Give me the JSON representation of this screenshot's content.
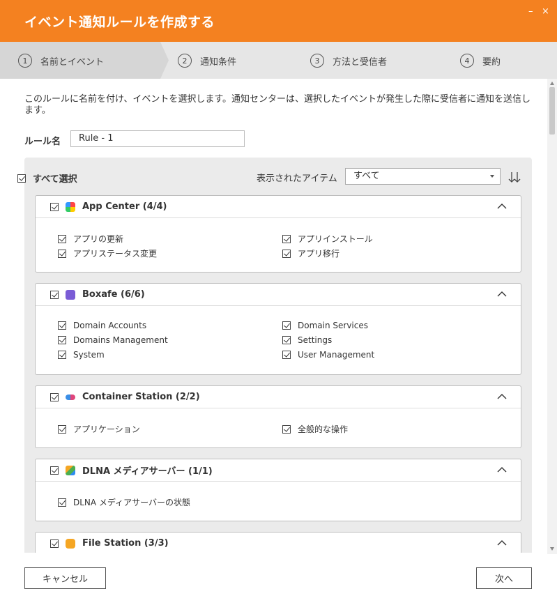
{
  "dialog": {
    "title": "イベント通知ルールを作成する",
    "minimize": "–",
    "close": "×"
  },
  "steps": [
    {
      "num": "1",
      "label": "名前とイベント"
    },
    {
      "num": "2",
      "label": "通知条件"
    },
    {
      "num": "3",
      "label": "方法と受信者"
    },
    {
      "num": "4",
      "label": "要約"
    }
  ],
  "description": "このルールに名前を付け、イベントを選択します。通知センターは、選択したイベントが発生した際に受信者に通知を送信します。",
  "rule": {
    "label": "ルール名",
    "value": "Rule - 1"
  },
  "filter": {
    "select_all": "すべて選択",
    "shown_label": "表示されたアイテム",
    "shown_value": "すべて"
  },
  "groups": [
    {
      "name": "App Center (4/4)",
      "icon": "app-center-icon",
      "items": [
        "アプリの更新",
        "アプリインストール",
        "アプリステータス変更",
        "アプリ移行"
      ]
    },
    {
      "name": "Boxafe (6/6)",
      "icon": "boxafe-icon",
      "items": [
        "Domain Accounts",
        "Domain Services",
        "Domains Management",
        "Settings",
        "System",
        "User Management"
      ]
    },
    {
      "name": "Container Station (2/2)",
      "icon": "container-station-icon",
      "items": [
        "アプリケーション",
        "全般的な操作"
      ]
    },
    {
      "name": "DLNA メディアサーバー (1/1)",
      "icon": "dlna-icon",
      "items": [
        "DLNA メディアサーバーの状態"
      ]
    },
    {
      "name": "File Station (3/3)",
      "icon": "file-station-icon",
      "items": []
    }
  ],
  "footer": {
    "cancel": "キャンセル",
    "next": "次へ"
  },
  "colors": {
    "accent": "#f48120",
    "steps_bg": "#e6e6e6",
    "panel_bg": "#ebebeb"
  }
}
